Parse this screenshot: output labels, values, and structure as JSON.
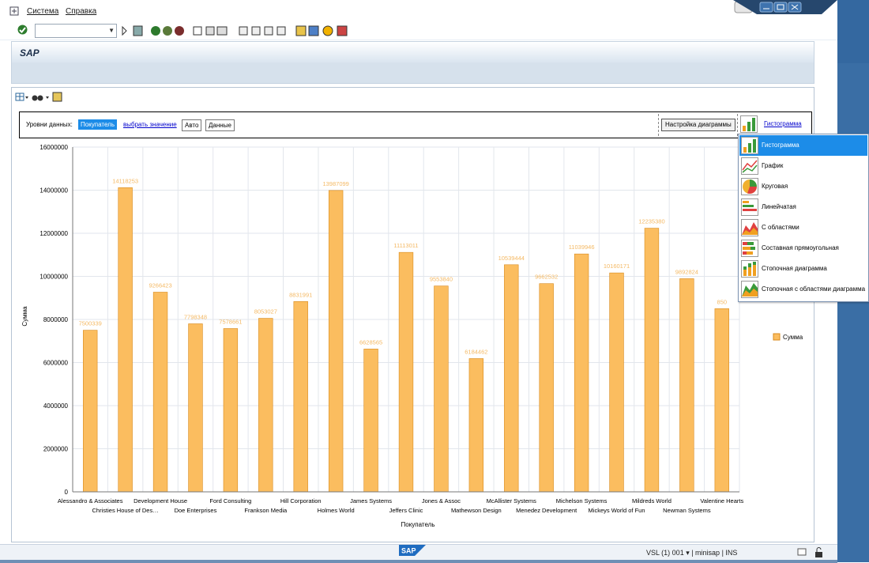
{
  "menu": {
    "system": "Система",
    "help": "Справка"
  },
  "header": {
    "title": "SAP"
  },
  "levels": {
    "label": "Уровни данных:",
    "active": "Покупатель",
    "select_link": "выбрать значение",
    "auto": "Авто",
    "data": "Данные"
  },
  "settings_button": "Настройка диаграммы",
  "chart_type_link": "Гистограмма",
  "dropdown": {
    "items": [
      {
        "label": "Гистограмма",
        "icon": "bar-chart-icon",
        "selected": true
      },
      {
        "label": "График",
        "icon": "line-chart-icon",
        "selected": false
      },
      {
        "label": "Круговая",
        "icon": "pie-chart-icon",
        "selected": false
      },
      {
        "label": "Линейчатая",
        "icon": "horizontal-bar-chart-icon",
        "selected": false
      },
      {
        "label": "С областями",
        "icon": "area-chart-icon",
        "selected": false
      },
      {
        "label": "Составная прямоугольная",
        "icon": "stacked-horizontal-bar-icon",
        "selected": false
      },
      {
        "label": "Стопочная диаграмма",
        "icon": "stacked-column-chart-icon",
        "selected": false
      },
      {
        "label": "Стопочная с областями диаграмма",
        "icon": "stacked-area-chart-icon",
        "selected": false
      }
    ]
  },
  "status": {
    "text": "VSL (1) 001  ▾  |  minisap  |  INS"
  },
  "colors": {
    "bar": "#fbbd5f",
    "bar_border": "#d88a1c",
    "label": "#f4b964",
    "accent": "#1c8ce8"
  },
  "chart_data": {
    "type": "bar",
    "xlabel": "Покупатель",
    "ylabel": "Сумма",
    "ylim": [
      0,
      16000000
    ],
    "yticks": [
      0,
      2000000,
      4000000,
      6000000,
      8000000,
      10000000,
      12000000,
      14000000,
      16000000
    ],
    "legend": "right",
    "grid": true,
    "categories": [
      "Alessandro & Associates",
      "Christies House of Des…",
      "Development House",
      "Doe Enterprises",
      "Ford Consulting",
      "Frankson Media",
      "Hill Corporation",
      "Holmes World",
      "James Systems",
      "Jeffers Clinic",
      "Jones & Assoc",
      "Mathewson Design",
      "McAllister Systems",
      "Menedez Development",
      "Michelson Systems",
      "Mickeys World of Fun",
      "Mildreds World",
      "Newman Systems",
      "Valentine Hearts"
    ],
    "series": [
      {
        "name": "Сумма",
        "values": [
          7500339,
          14118253,
          9266423,
          7798348,
          7578661,
          8053027,
          8831991,
          13987099,
          6628565,
          11113011,
          9553840,
          6184462,
          10539444,
          9662532,
          11039946,
          10160171,
          12235380,
          9892824,
          8500000
        ],
        "labels": [
          "7500339",
          "14118253",
          "9266423",
          "7798348",
          "7578661",
          "8053027",
          "8831991",
          "13987099",
          "6628565",
          "11113011",
          "9553840",
          "6184462",
          "10539444",
          "9662532",
          "11039946",
          "10160171",
          "12235380",
          "9892824",
          "850"
        ]
      }
    ]
  }
}
